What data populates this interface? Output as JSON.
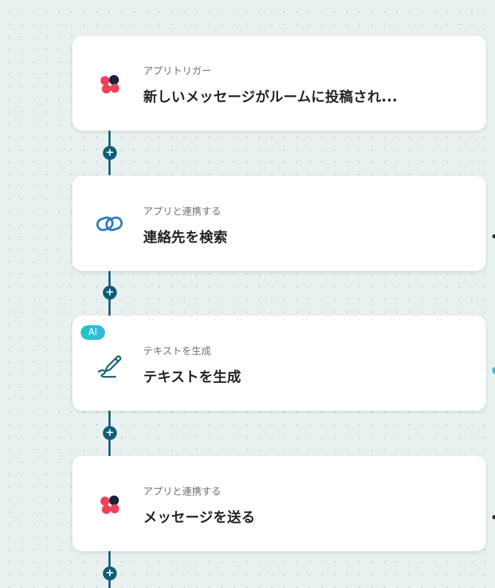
{
  "steps": [
    {
      "label": "アプリトリガー",
      "title": "新しいメッセージがルームに投稿され...",
      "icon": "chatwork-icon"
    },
    {
      "label": "アプリと連携する",
      "title": "連絡先を検索",
      "icon": "zoho-crm-icon"
    },
    {
      "label": "テキストを生成",
      "title": "テキストを生成",
      "icon": "pen-icon",
      "badge": "AI"
    },
    {
      "label": "アプリと連携する",
      "title": "メッセージを送る",
      "icon": "chatwork-icon"
    }
  ],
  "add_button_symbol": "+",
  "colors": {
    "connector": "#0e5e78",
    "chatwork_red": "#ef4058",
    "chatwork_dark": "#17233a",
    "zoho_blue": "#2f7bc0",
    "pen_teal": "#18627c",
    "ai_badge": "#26c0d6"
  }
}
